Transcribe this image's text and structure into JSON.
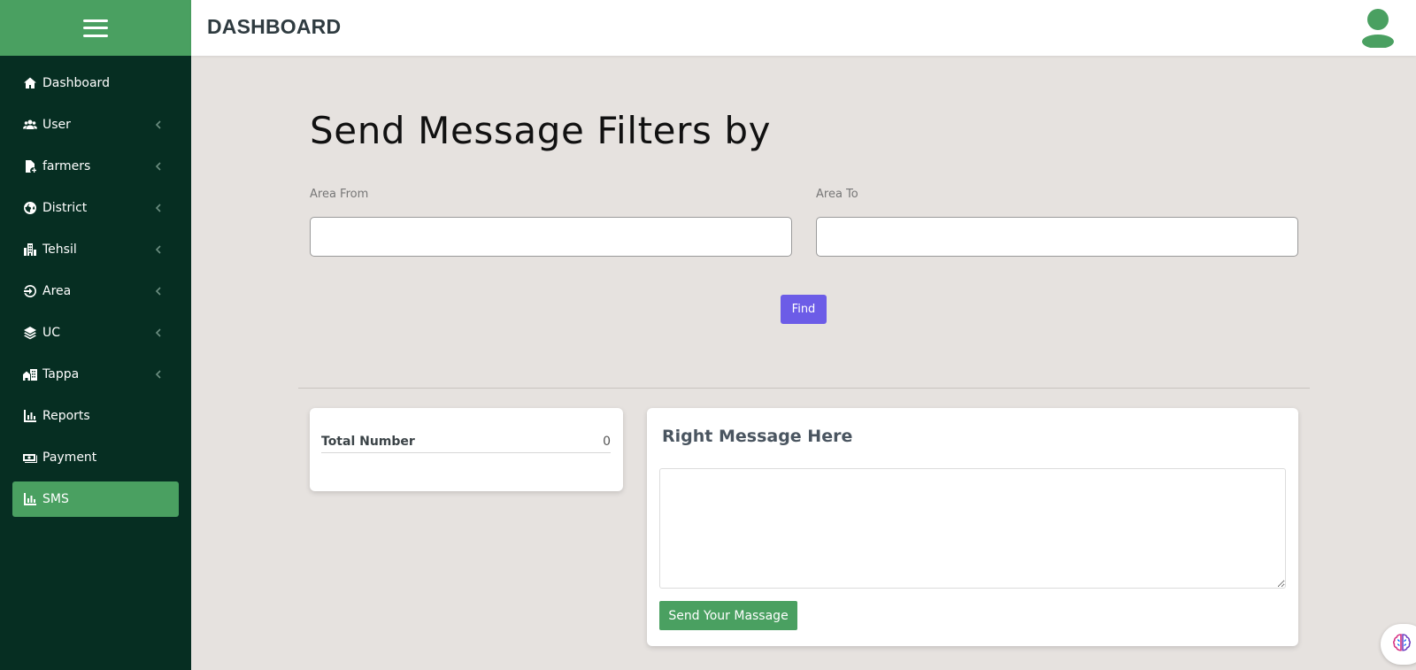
{
  "header": {
    "title": "DASHBOARD"
  },
  "sidebar": {
    "items": [
      {
        "label": "Dashboard",
        "icon": "home-icon",
        "has_submenu": false
      },
      {
        "label": "User",
        "icon": "users-icon",
        "has_submenu": true
      },
      {
        "label": "farmers",
        "icon": "file-plus-icon",
        "has_submenu": true
      },
      {
        "label": "District",
        "icon": "globe-icon",
        "has_submenu": true
      },
      {
        "label": "Tehsil",
        "icon": "building-icon",
        "has_submenu": true
      },
      {
        "label": "Area",
        "icon": "sign-in-icon",
        "has_submenu": true
      },
      {
        "label": "UC",
        "icon": "layers-icon",
        "has_submenu": true
      },
      {
        "label": "Tappa",
        "icon": "city-icon",
        "has_submenu": true
      },
      {
        "label": "Reports",
        "icon": "bar-chart-icon",
        "has_submenu": false
      },
      {
        "label": "Payment",
        "icon": "money-icon",
        "has_submenu": false
      },
      {
        "label": "SMS",
        "icon": "bar-chart-icon",
        "has_submenu": false,
        "active": true
      }
    ]
  },
  "main": {
    "title": "Send Message Filters by",
    "area_from_label": "Area From",
    "area_from_value": "",
    "area_to_label": "Area To",
    "area_to_value": "",
    "find_label": "Find"
  },
  "total_card": {
    "label": "Total Number",
    "value": "0"
  },
  "message_card": {
    "title": "Right Message Here",
    "message_value": "",
    "send_label": "Send Your Massage"
  },
  "colors": {
    "sidebar_bg": "#062e22",
    "accent_green": "#4aa061",
    "find_button": "#6c5ce7",
    "page_bg": "#e6e2df"
  }
}
